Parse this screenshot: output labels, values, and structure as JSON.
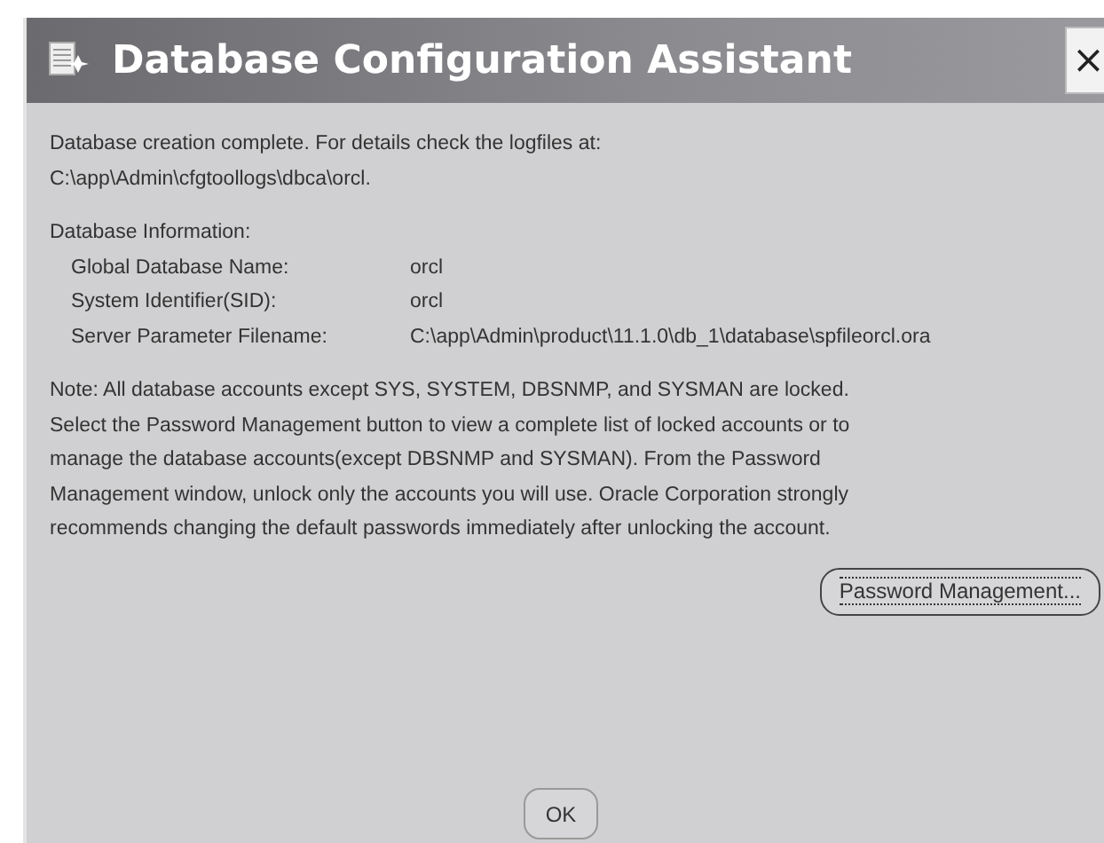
{
  "window": {
    "title": "Database Configuration Assistant",
    "close": "×"
  },
  "completion_lines": [
    "Database creation complete. For details check the logfiles at:",
    " C:\\app\\Admin\\cfgtoollogs\\dbca\\orcl."
  ],
  "info_heading": "Database Information:",
  "info_rows": [
    {
      "label": "Global Database Name:",
      "value": "orcl"
    },
    {
      "label": "System Identifier(SID):",
      "value": "orcl"
    },
    {
      "label": "Server Parameter Filename:",
      "value": "C:\\app\\Admin\\product\\11.1.0\\db_1\\database\\spfileorcl.ora"
    }
  ],
  "note_lines": [
    "Note: All database accounts except SYS, SYSTEM, DBSNMP, and SYSMAN are locked.",
    "Select the Password Management button to view a complete list of locked accounts or to",
    "manage the database accounts(except DBSNMP and SYSMAN). From the Password",
    "Management window, unlock only the accounts you will use. Oracle Corporation strongly",
    "recommends changing the default passwords immediately after unlocking the account."
  ],
  "password_button": {
    "label": "Password Management...",
    "focused": true
  },
  "ok_button": {
    "label": "OK"
  }
}
